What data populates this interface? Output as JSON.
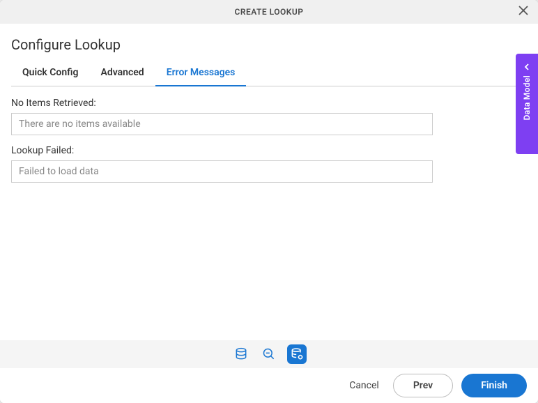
{
  "modal": {
    "title": "CREATE LOOKUP"
  },
  "section": {
    "title": "Configure Lookup"
  },
  "tabs": {
    "quick": "Quick Config",
    "advanced": "Advanced",
    "errors": "Error Messages"
  },
  "fields": {
    "noItems": {
      "label": "No Items Retrieved:",
      "placeholder": "There are no items available",
      "value": ""
    },
    "lookupFailed": {
      "label": "Lookup Failed:",
      "placeholder": "Failed to load data",
      "value": ""
    }
  },
  "sidePanel": {
    "label": "Data Model"
  },
  "footer": {
    "cancel": "Cancel",
    "prev": "Prev",
    "finish": "Finish"
  }
}
